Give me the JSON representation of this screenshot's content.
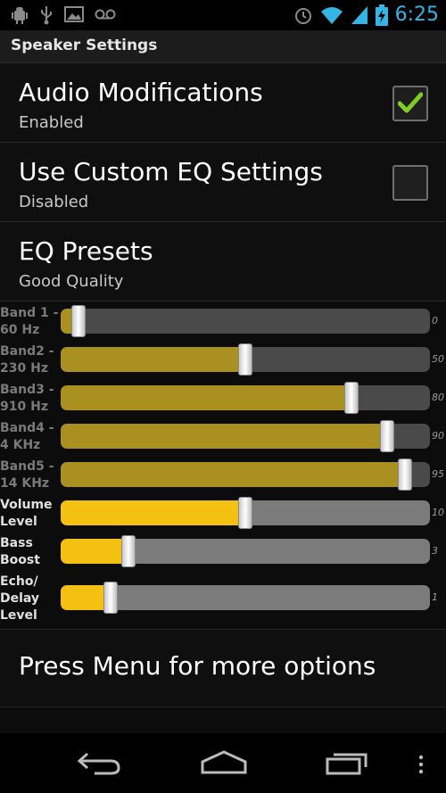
{
  "status_bar": {
    "icons_left": [
      "android-debug-icon",
      "usb-icon",
      "image-icon",
      "voicemail-icon"
    ],
    "icons_right": [
      "alarm-icon",
      "wifi-icon",
      "signal-icon",
      "battery-charging-icon"
    ],
    "time": "6:25",
    "accent": "#33b5e5"
  },
  "titlebar": {
    "title": "Speaker Settings"
  },
  "prefs": [
    {
      "title": "Audio Modifications",
      "summary": "Enabled",
      "checked": true
    },
    {
      "title": "Use Custom EQ Settings",
      "summary": "Disabled",
      "checked": false
    },
    {
      "title": "EQ Presets",
      "summary": "Good Quality"
    }
  ],
  "sliders": [
    {
      "label_line1": "Band 1 -",
      "label_line2": "60 Hz",
      "value": "0",
      "level": 0.03
    },
    {
      "label_line1": "Band2 -",
      "label_line2": "230 Hz",
      "value": "50",
      "level": 0.5
    },
    {
      "label_line1": "Band3 -",
      "label_line2": "910 Hz",
      "value": "80",
      "level": 0.8
    },
    {
      "label_line1": "Band4 -",
      "label_line2": "4 KHz",
      "value": "90",
      "level": 0.9
    },
    {
      "label_line1": "Band5 -",
      "label_line2": "14 KHz",
      "value": "95",
      "level": 0.95
    },
    {
      "label_line1": "Volume",
      "label_line2": "Level",
      "value": "10",
      "level": 0.5
    },
    {
      "label_line1": "Bass",
      "label_line2": "Boost",
      "value": "3",
      "level": 0.17
    },
    {
      "label_line1": "Echo/",
      "label_line2": "Delay",
      "label_line3": "Level",
      "value": "1",
      "level": 0.12
    }
  ],
  "footer": {
    "text": "Press Menu for more options"
  },
  "colors": {
    "band_fill": "#a99020",
    "level_fill": "#f4c011",
    "check": "#7fcd20"
  }
}
